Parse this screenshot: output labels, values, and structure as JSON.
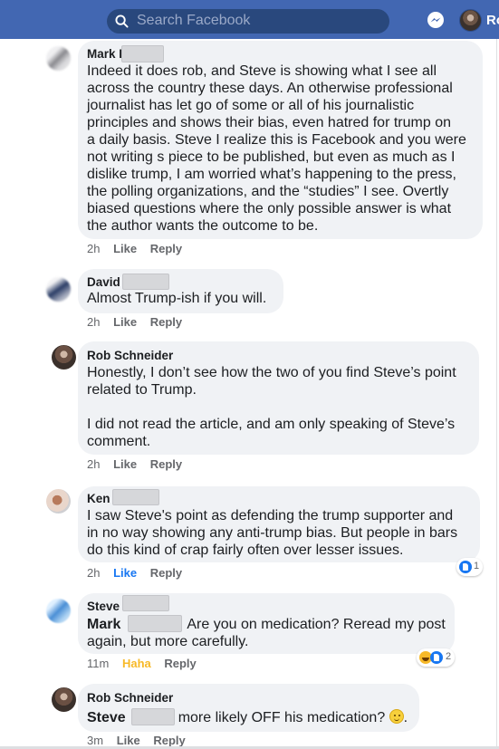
{
  "header": {
    "search_placeholder": "Search Facebook",
    "user_short": "Ro"
  },
  "comments": [
    {
      "name": "Mark I",
      "lines": [
        "Indeed it does rob, and Steve is showing what I see all",
        "across the country these days.  An otherwise professional",
        "journalist has let go of some or all of his journalistic",
        "principles and shows their bias, even hatred for trump on",
        "a daily basis.  Steve I realize this is Facebook and you were",
        "not writing s piece to be published, but even as much as I",
        "dislike trump, I am worried what’s happening to the press,",
        "the polling organizations, and the “studies” I see.   Overtly",
        "biased questions where the only possible answer is what",
        "the author wants the outcome to be."
      ],
      "time": "2h",
      "like": "Like",
      "reply": "Reply"
    },
    {
      "name": "David",
      "lines": [
        "Almost Trump-ish if you will."
      ],
      "time": "2h",
      "like": "Like",
      "reply": "Reply"
    },
    {
      "name": "Rob Schneider",
      "lines": [
        "Honestly, I don’t see how the two of you find Steve’s point",
        "related to Trump.",
        "",
        "I did not read the article, and am only speaking of Steve’s",
        "comment."
      ],
      "time": "2h",
      "like": "Like",
      "reply": "Reply"
    },
    {
      "name": "Ken",
      "lines": [
        "I saw Steve's point as defending the trump supporter and",
        "in no way showing any anti-trump bias.  But people in bars",
        "do this kind of crap fairly often over lesser issues."
      ],
      "time": "2h",
      "like": "Like",
      "reply": "Reply",
      "reaction_count": "1"
    },
    {
      "name": "Steve",
      "tag": "Mark",
      "line1_rest": "Are you on medication? Reread my post",
      "line2": "again, but more carefully.",
      "time": "11m",
      "like": "Haha",
      "reply": "Reply",
      "reaction_count": "2"
    },
    {
      "name": "Rob Schneider",
      "tag": "Steve",
      "line1_rest": "more likely OFF his medication?",
      "time": "3m",
      "like": "Like",
      "reply": "Reply"
    }
  ],
  "colors": {
    "topbar": "#4267b2",
    "bubble": "#f0f2f5",
    "like_blue": "#1877f2",
    "haha_yellow": "#f7b928"
  },
  "icons": [
    "search-icon",
    "messenger-icon",
    "like-reaction-icon",
    "haha-reaction-icon",
    "smiley-emoji-icon"
  ]
}
